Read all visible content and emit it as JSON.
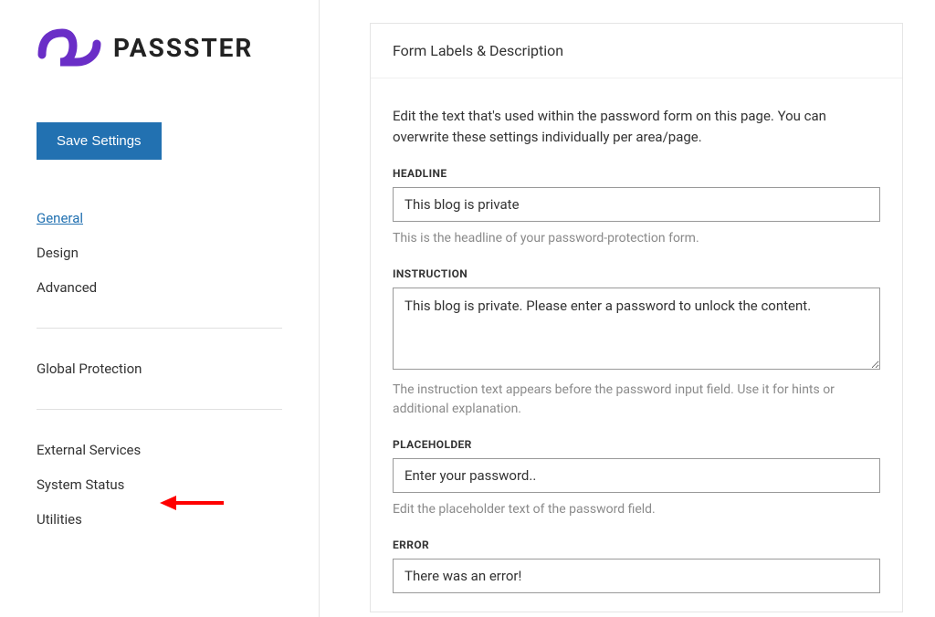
{
  "brand": {
    "name": "PASSSTER",
    "accent": "#6a2ec7"
  },
  "sidebar": {
    "save_label": "Save Settings",
    "groups": [
      {
        "items": [
          {
            "label": "General",
            "name": "sidebar-item-general",
            "active": true
          },
          {
            "label": "Design",
            "name": "sidebar-item-design"
          },
          {
            "label": "Advanced",
            "name": "sidebar-item-advanced"
          }
        ]
      },
      {
        "items": [
          {
            "label": "Global Protection",
            "name": "sidebar-item-global-protection"
          }
        ]
      },
      {
        "items": [
          {
            "label": "External Services",
            "name": "sidebar-item-external-services"
          },
          {
            "label": "System Status",
            "name": "sidebar-item-system-status"
          },
          {
            "label": "Utilities",
            "name": "sidebar-item-utilities"
          }
        ]
      }
    ]
  },
  "panel": {
    "title": "Form Labels & Description",
    "intro": "Edit the text that's used within the password form on this page. You can overwrite these settings individually per area/page.",
    "headline": {
      "label": "HEADLINE",
      "value": "This blog is private",
      "help": "This is the headline of your password-protection form."
    },
    "instruction": {
      "label": "INSTRUCTION",
      "value": "This blog is private. Please enter a password to unlock the content.",
      "help": "The instruction text appears before the password input field. Use it for hints or additional explanation."
    },
    "placeholder": {
      "label": "PLACEHOLDER",
      "value": "Enter your password..",
      "help": "Edit the placeholder text of the password field."
    },
    "error": {
      "label": "ERROR",
      "value": "There was an error!"
    }
  }
}
